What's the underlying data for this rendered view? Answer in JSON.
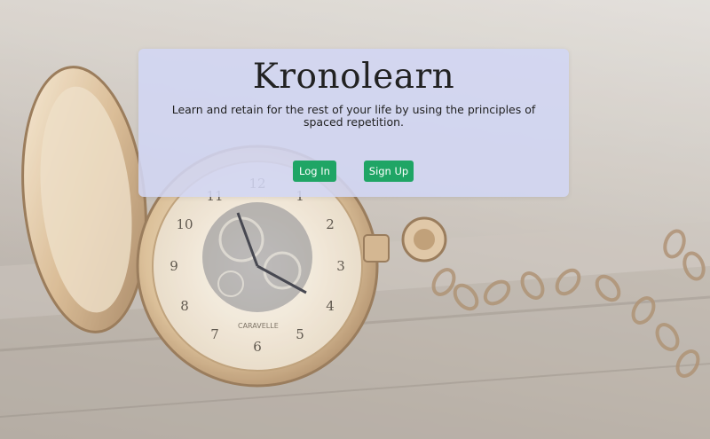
{
  "hero": {
    "title": "Kronolearn",
    "tagline": "Learn and retain for the rest of your life by using the principles of spaced repetition."
  },
  "actions": {
    "login_label": "Log In",
    "signup_label": "Sign Up"
  },
  "colors": {
    "card_background": "#d2d6f4",
    "button": "#1fa565",
    "button_text": "#ffffff",
    "text": "#222222"
  },
  "background": {
    "image": "pocket-watch-photo",
    "dial_brand": "CARAVELLE",
    "dial_numerals": [
      "12",
      "1",
      "2",
      "3",
      "4",
      "5",
      "6",
      "7",
      "8",
      "9",
      "10",
      "11"
    ]
  }
}
